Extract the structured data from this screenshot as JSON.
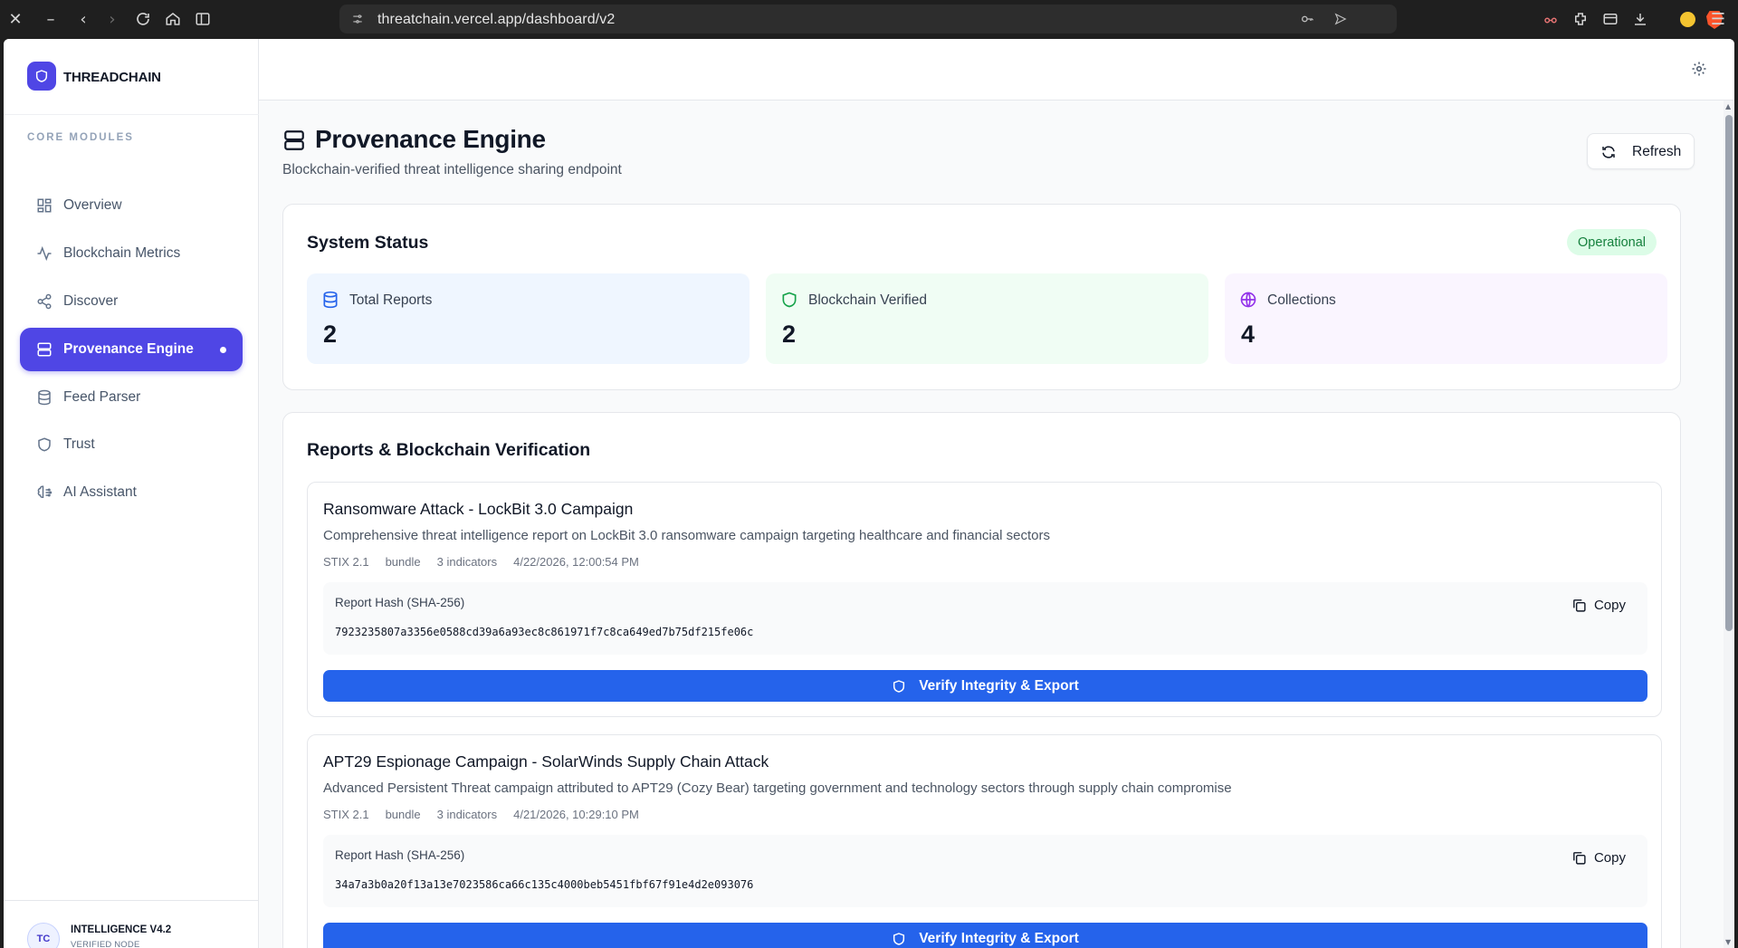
{
  "browser": {
    "url": "threatchain.vercel.app/dashboard/v2"
  },
  "sidebar": {
    "brand": "THREADCHAIN",
    "section_label": "CORE MODULES",
    "items": [
      {
        "label": "Overview",
        "icon": "grid-icon"
      },
      {
        "label": "Blockchain Metrics",
        "icon": "activity-icon"
      },
      {
        "label": "Discover",
        "icon": "share-icon"
      },
      {
        "label": "Provenance Engine",
        "icon": "server-icon",
        "active": true
      },
      {
        "label": "Feed Parser",
        "icon": "database-icon"
      },
      {
        "label": "Trust",
        "icon": "shield-icon"
      },
      {
        "label": "AI Assistant",
        "icon": "brain-icon"
      }
    ],
    "footer": {
      "avatar": "TC",
      "title": "INTELLIGENCE V4.2",
      "subtitle": "VERIFIED NODE"
    }
  },
  "page": {
    "title": "Provenance Engine",
    "subtitle": "Blockchain-verified threat intelligence sharing endpoint",
    "refresh_label": "Refresh"
  },
  "system_status": {
    "title": "System Status",
    "badge": "Operational",
    "badge_color": "#15803d",
    "stats": [
      {
        "label": "Total Reports",
        "value": "2",
        "color": "#2563eb"
      },
      {
        "label": "Blockchain Verified",
        "value": "2",
        "color": "#16a34a"
      },
      {
        "label": "Collections",
        "value": "4",
        "color": "#9333ea"
      }
    ]
  },
  "reports_section": {
    "title": "Reports & Blockchain Verification",
    "hash_label": "Report Hash (SHA-256)",
    "copy_label": "Copy",
    "verify_label": "Verify Integrity & Export",
    "reports": [
      {
        "title": "Ransomware Attack - LockBit 3.0 Campaign",
        "description": "Comprehensive threat intelligence report on LockBit 3.0 ransomware campaign targeting healthcare and financial sectors",
        "spec": "STIX 2.1",
        "type": "bundle",
        "indicators": "3 indicators",
        "timestamp": "4/22/2026, 12:00:54 PM",
        "hash": "7923235807a3356e0588cd39a6a93ec8c861971f7c8ca649ed7b75df215fe06c"
      },
      {
        "title": "APT29 Espionage Campaign - SolarWinds Supply Chain Attack",
        "description": "Advanced Persistent Threat campaign attributed to APT29 (Cozy Bear) targeting government and technology sectors through supply chain compromise",
        "spec": "STIX 2.1",
        "type": "bundle",
        "indicators": "3 indicators",
        "timestamp": "4/21/2026, 10:29:10 PM",
        "hash": "34a7a3b0a20f13a13e7023586ca66c135c4000beb5451fbf67f91e4d2e093076"
      }
    ]
  },
  "colors": {
    "accent": "#4f46e5",
    "primary_button": "#2563eb"
  }
}
